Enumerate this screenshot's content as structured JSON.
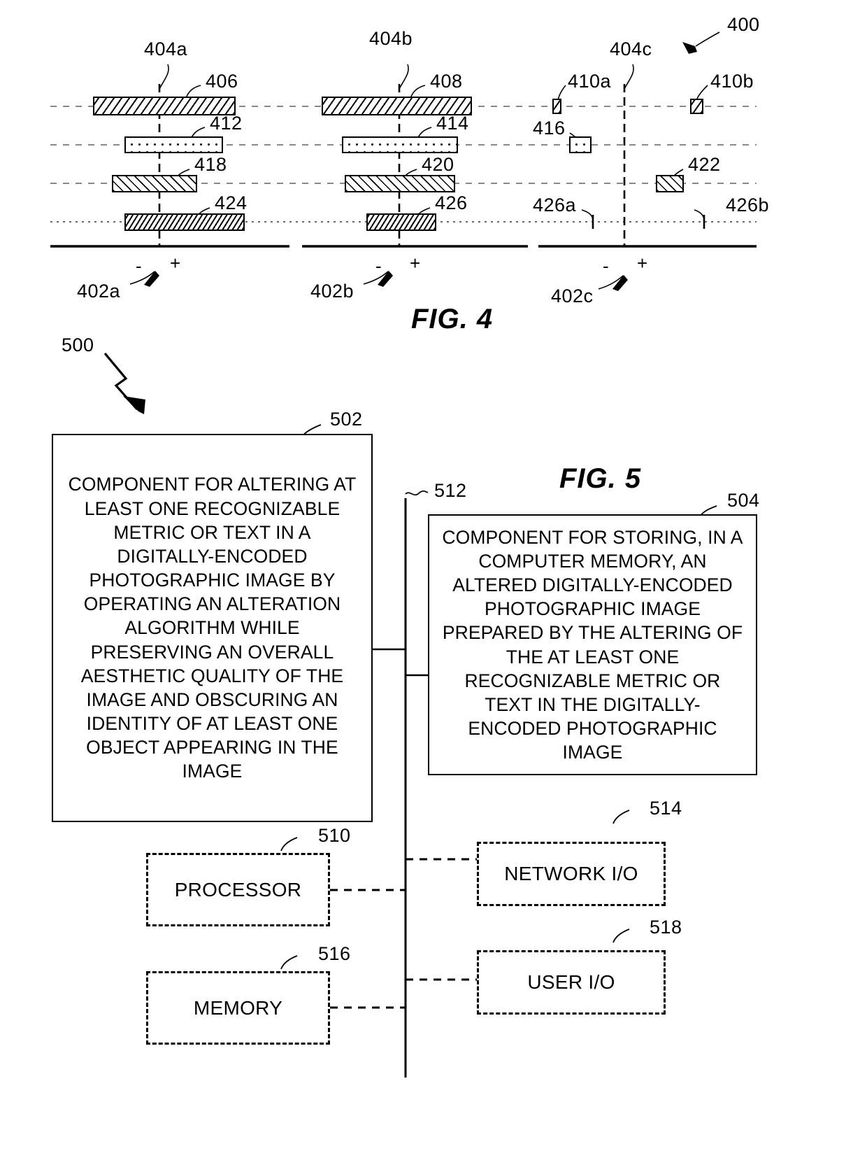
{
  "figure4": {
    "label": "FIG. 4",
    "overall_ref": "400",
    "panels": [
      {
        "axis_ref": "404a",
        "baseline_ref": "402a",
        "minus": "-",
        "plus": "+"
      },
      {
        "axis_ref": "404b",
        "baseline_ref": "402b",
        "minus": "-",
        "plus": "+"
      },
      {
        "axis_ref": "404c",
        "baseline_ref": "402c",
        "minus": "-",
        "plus": "+"
      }
    ],
    "bar_refs": {
      "row1_a": "406",
      "row1_b": "408",
      "row1_c_left": "410a",
      "row1_c_right": "410b",
      "row2_a": "412",
      "row2_b": "414",
      "row2_c": "416",
      "row3_a": "418",
      "row3_b": "420",
      "row3_c": "422",
      "row4_a": "424",
      "row4_b": "426",
      "row4_c_left": "426a",
      "row4_c_right": "426b"
    }
  },
  "figure5": {
    "label": "FIG. 5",
    "overall_ref": "500",
    "bus_ref": "512",
    "blocks": [
      {
        "ref": "502",
        "text": "COMPONENT FOR ALTERING AT LEAST ONE RECOGNIZABLE METRIC OR TEXT IN A DIGITALLY-ENCODED PHOTOGRAPHIC IMAGE BY OPERATING AN ALTERATION ALGORITHM WHILE PRESERVING AN OVERALL AESTHETIC QUALITY OF THE IMAGE AND OBSCURING AN IDENTITY OF AT LEAST ONE OBJECT APPEARING IN THE IMAGE"
      },
      {
        "ref": "504",
        "text": "COMPONENT FOR STORING, IN A COMPUTER MEMORY, AN ALTERED DIGITALLY-ENCODED PHOTOGRAPHIC IMAGE PREPARED BY THE ALTERING OF THE AT LEAST ONE RECOGNIZABLE METRIC OR TEXT IN THE DIGITALLY-ENCODED PHOTOGRAPHIC IMAGE"
      },
      {
        "ref": "510",
        "text": "PROCESSOR"
      },
      {
        "ref": "514",
        "text": "NETWORK I/O"
      },
      {
        "ref": "516",
        "text": "MEMORY"
      },
      {
        "ref": "518",
        "text": "USER I/O"
      }
    ]
  }
}
